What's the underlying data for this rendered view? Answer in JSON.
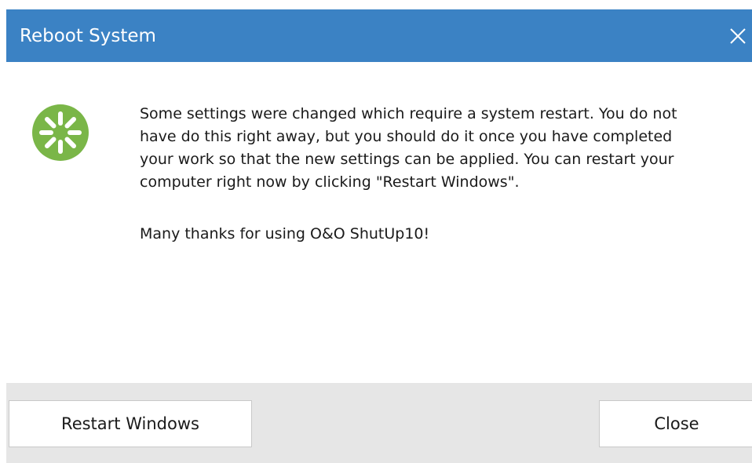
{
  "dialog": {
    "title": "Reboot System",
    "close_icon": "close-icon",
    "accent_color": "#3b82c4"
  },
  "body": {
    "icon": "restart-spinner-icon",
    "icon_color": "#7ab648",
    "message": "Some settings were changed which require a system restart. You do not\nhave do this right away, but you should do it once you have completed\nyour work so that the new settings can be applied. You can restart your\ncomputer right now by clicking \"Restart Windows\".",
    "thanks": "Many thanks for using O&O ShutUp10!"
  },
  "footer": {
    "restart_label": "Restart Windows",
    "close_label": "Close"
  }
}
